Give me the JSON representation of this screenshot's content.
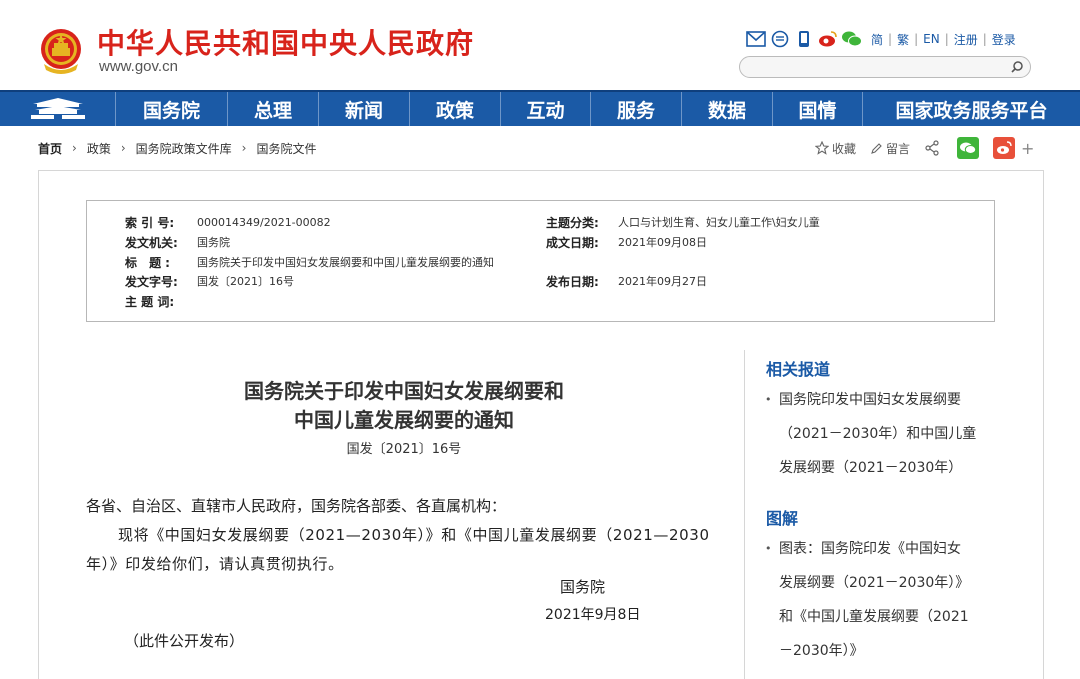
{
  "header": {
    "site_title": "中华人民共和国中央人民政府",
    "site_url": "www.gov.cn",
    "lang_links": [
      "简",
      "繁",
      "EN",
      "注册",
      "登录"
    ]
  },
  "nav": {
    "items": [
      "国务院",
      "总理",
      "新闻",
      "政策",
      "互动",
      "服务",
      "数据",
      "国情",
      "国家政务服务平台"
    ]
  },
  "breadcrumb": {
    "home": "首页",
    "items": [
      "政策",
      "国务院政策文件库",
      "国务院文件"
    ]
  },
  "share": {
    "favorite": "收藏",
    "comment": "留言"
  },
  "meta": {
    "index_label": "索 引 号:",
    "index_value": "000014349/2021-00082",
    "category_label": "主题分类:",
    "category_value": "人口与计划生育、妇女儿童工作\\妇女儿童",
    "issuer_label": "发文机关:",
    "issuer_value": "国务院",
    "written_date_label": "成文日期:",
    "written_date_value": "2021年09月08日",
    "title_label": "标 题:",
    "title_value": "国务院关于印发中国妇女发展纲要和中国儿童发展纲要的通知",
    "doc_no_label": "发文字号:",
    "doc_no_value": "国发〔2021〕16号",
    "publish_date_label": "发布日期:",
    "publish_date_value": "2021年09月27日",
    "keywords_label": "主 题 词:",
    "keywords_value": ""
  },
  "article": {
    "title_line1": "国务院关于印发中国妇女发展纲要和",
    "title_line2": "中国儿童发展纲要的通知",
    "doc_number": "国发〔2021〕16号",
    "salutation": "各省、自治区、直辖市人民政府，国务院各部委、各直属机构：",
    "body": "现将《中国妇女发展纲要（2021—2030年）》和《中国儿童发展纲要（2021—2030年）》印发给你们，请认真贯彻执行。",
    "signature": "国务院",
    "sign_date": "2021年9月8日",
    "publish_note": "（此件公开发布）"
  },
  "sidebar": {
    "related_heading": "相关报道",
    "related_item": {
      "line1": "国务院印发中国妇女发展纲要",
      "line2": "（2021－2030年）和中国儿童",
      "line3": "发展纲要（2021－2030年）"
    },
    "graphic_heading": "图解",
    "graphic_item": {
      "line1": "图表：国务院印发《中国妇女",
      "line2": "发展纲要（2021－2030年）》",
      "line3": "和《中国儿童发展纲要（2021",
      "line4": "－2030年）》"
    }
  },
  "colors": {
    "brand_red": "#d8231b",
    "nav_blue": "#1b5aa6",
    "wechat_green": "#3fb53a",
    "weibo_red": "#e8503a"
  }
}
